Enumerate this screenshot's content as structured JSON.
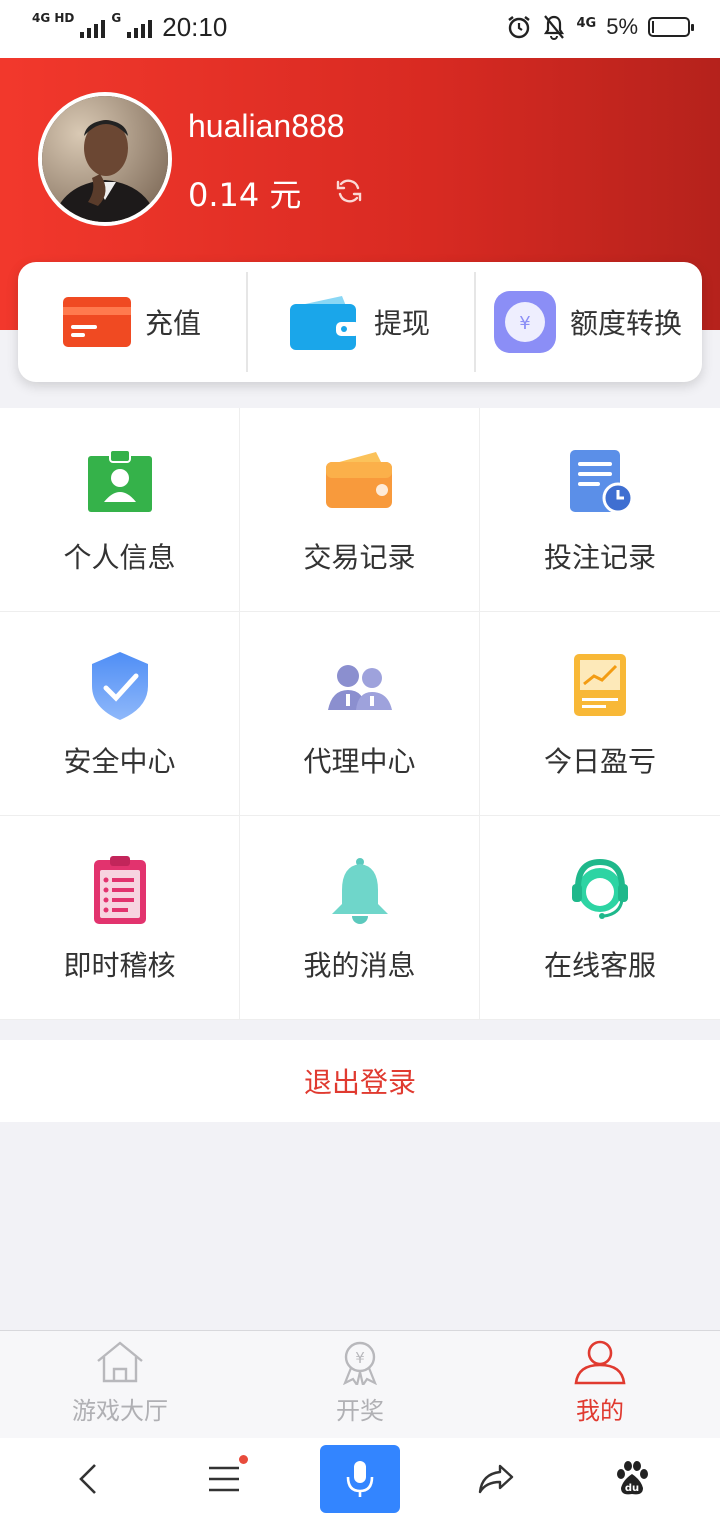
{
  "status_bar": {
    "network_left": "4G HD",
    "network_right_label": "G",
    "time": "20:10",
    "network_4g": "4G",
    "battery_percent": "5%",
    "battery_level": 0.05
  },
  "header": {
    "username": "hualian888",
    "balance": "0.14 元",
    "avatar_icon": "avatar-photo",
    "refresh_icon": "refresh-icon",
    "gradient_start": "#f2382c",
    "gradient_end": "#b5221c"
  },
  "actions": [
    {
      "label": "充值",
      "icon": "recharge-card-icon"
    },
    {
      "label": "提现",
      "icon": "wallet-icon"
    },
    {
      "label": "额度转换",
      "icon": "yen-exchange-icon"
    }
  ],
  "menu": [
    {
      "label": "个人信息",
      "icon": "id-badge-icon"
    },
    {
      "label": "交易记录",
      "icon": "wallet-record-icon"
    },
    {
      "label": "投注记录",
      "icon": "document-clock-icon"
    },
    {
      "label": "安全中心",
      "icon": "shield-check-icon"
    },
    {
      "label": "代理中心",
      "icon": "users-icon"
    },
    {
      "label": "今日盈亏",
      "icon": "chart-board-icon"
    },
    {
      "label": "即时稽核",
      "icon": "clipboard-checklist-icon"
    },
    {
      "label": "我的消息",
      "icon": "bell-icon"
    },
    {
      "label": "在线客服",
      "icon": "headset-agent-icon"
    }
  ],
  "logout": {
    "label": "退出登录",
    "color": "#e03a30"
  },
  "tabbar": {
    "items": [
      {
        "label": "游戏大厅",
        "icon": "home-icon",
        "active": false
      },
      {
        "label": "开奖",
        "icon": "award-medal-icon",
        "active": false
      },
      {
        "label": "我的",
        "icon": "user-icon",
        "active": true
      }
    ],
    "active_color": "#e03a30",
    "inactive_color": "#b0b0b4"
  },
  "browser_bar": {
    "items": [
      "back-icon",
      "menu-icon",
      "microphone-icon",
      "share-icon",
      "baidu-paw-icon"
    ],
    "mic_color": "#3385ff"
  }
}
